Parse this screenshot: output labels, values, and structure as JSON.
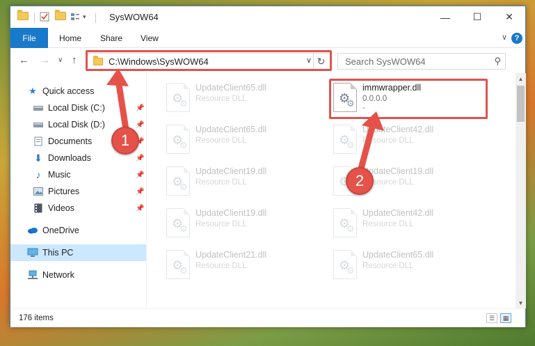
{
  "window": {
    "title": "SysWOW64",
    "minimize_glyph": "—",
    "maximize_glyph": "☐",
    "close_glyph": "✕"
  },
  "ribbon": {
    "file_label": "File",
    "tabs": [
      "Home",
      "Share",
      "View"
    ],
    "help_glyph": "?",
    "collapse_glyph": "∨"
  },
  "navigation": {
    "back_glyph": "←",
    "forward_glyph": "→",
    "recent_glyph": "∨",
    "up_glyph": "↑",
    "address": "C:\\Windows\\SysWOW64",
    "refresh_glyph": "↻",
    "search_placeholder": "Search SysWOW64"
  },
  "sidebar": {
    "items": [
      {
        "label": "Quick access",
        "icon": "star-icon",
        "pinned": false
      },
      {
        "label": "Local Disk (C:)",
        "icon": "drive-icon",
        "pinned": true
      },
      {
        "label": "Local Disk (D:)",
        "icon": "drive-icon",
        "pinned": true
      },
      {
        "label": "Documents",
        "icon": "documents-icon",
        "pinned": true
      },
      {
        "label": "Downloads",
        "icon": "downloads-icon",
        "pinned": true
      },
      {
        "label": "Music",
        "icon": "music-icon",
        "pinned": true
      },
      {
        "label": "Pictures",
        "icon": "pictures-icon",
        "pinned": true
      },
      {
        "label": "Videos",
        "icon": "videos-icon",
        "pinned": true
      },
      {
        "label": "OneDrive",
        "icon": "onedrive-icon",
        "pinned": false
      },
      {
        "label": "This PC",
        "icon": "computer-icon",
        "pinned": false,
        "selected": true
      },
      {
        "label": "Network",
        "icon": "network-icon",
        "pinned": false
      }
    ]
  },
  "files": {
    "left_column": [
      {
        "name": "UpdateClient65.dll",
        "type": "Resource DLL"
      },
      {
        "name": "UpdateClient65.dll",
        "type": "Resource DLL"
      },
      {
        "name": "UpdateClient19.dll",
        "type": "Resource DLL"
      },
      {
        "name": "UpdateClient19.dll",
        "type": "Resource DLL"
      },
      {
        "name": "UpdateClient21.dll",
        "type": "Resource DLL"
      }
    ],
    "right_column": [
      {
        "name": "immwrapper.dll",
        "type": "0.0.0.0",
        "extra": "-",
        "highlighted": true
      },
      {
        "name": "UpdateClient42.dll",
        "type": "Resource DLL"
      },
      {
        "name": "UpdateClient19.dll",
        "type": "Resource DLL"
      },
      {
        "name": "UpdateClient42.dll",
        "type": "Resource DLL"
      },
      {
        "name": "UpdateClient65.dll",
        "type": "Resource DLL"
      }
    ]
  },
  "status": {
    "item_count": "176 items"
  },
  "annotations": {
    "step1": "1",
    "step2": "2",
    "color": "#e5524a"
  }
}
